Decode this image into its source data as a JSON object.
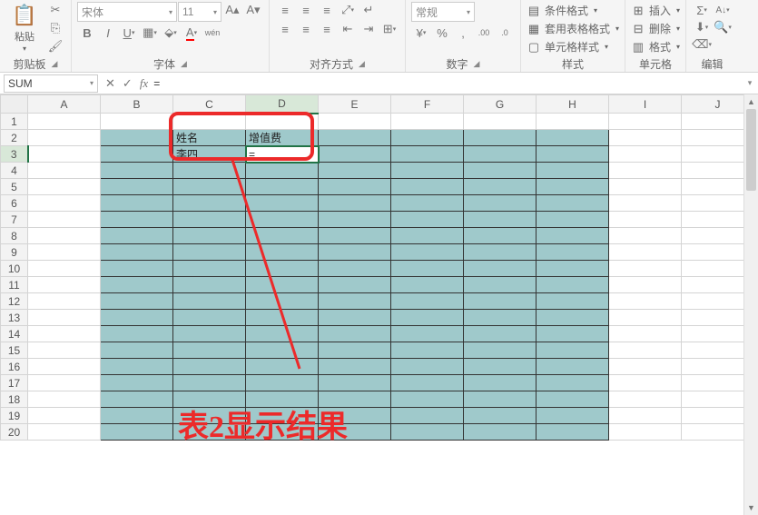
{
  "ribbon": {
    "clipboard": {
      "label": "剪贴板",
      "paste": "粘贴"
    },
    "font": {
      "label": "字体",
      "name": "宋体",
      "size": "11"
    },
    "alignment": {
      "label": "对齐方式"
    },
    "number": {
      "label": "数字",
      "format": "常规"
    },
    "styles": {
      "label": "样式",
      "cond_format": "条件格式",
      "table_format": "套用表格格式",
      "cell_style": "单元格样式"
    },
    "cells": {
      "label": "单元格",
      "insert": "插入",
      "delete": "删除",
      "format": "格式"
    },
    "editing": {
      "label": "编辑"
    }
  },
  "namebox": "SUM",
  "formula": "=",
  "columns": [
    "A",
    "B",
    "C",
    "D",
    "E",
    "F",
    "G",
    "H",
    "I",
    "J"
  ],
  "rows": [
    1,
    2,
    3,
    4,
    5,
    6,
    7,
    8,
    9,
    10,
    11,
    12,
    13,
    14,
    15,
    16,
    17,
    18,
    19,
    20
  ],
  "active_cell": "D3",
  "cells": {
    "C2": "姓名",
    "D2": "增值费",
    "C3": "李四",
    "D3": "="
  },
  "blue_region": {
    "col_start": "B",
    "col_end": "H",
    "row_start": 2,
    "row_end": 20
  },
  "annotation_text": "表2显示结果",
  "chart_data": null
}
